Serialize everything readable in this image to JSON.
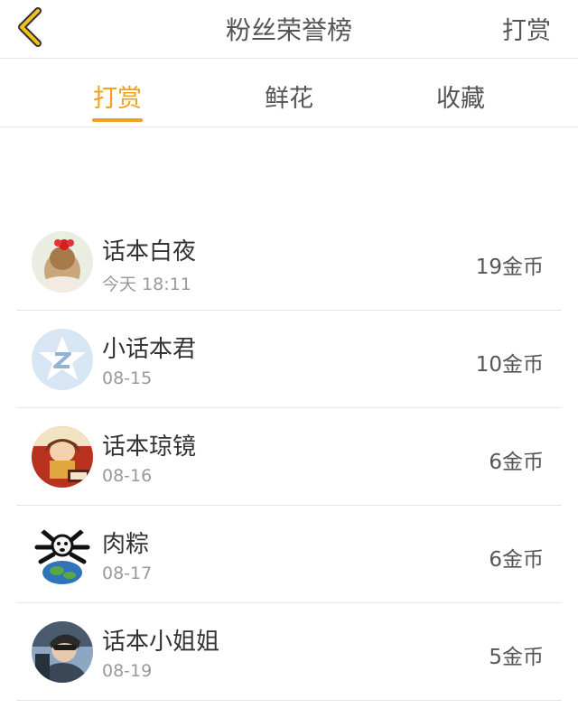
{
  "header": {
    "title": "粉丝荣誉榜",
    "action_label": "打赏",
    "back_icon": "chevron-left-icon",
    "accent_color": "#f0a01c"
  },
  "tabs": [
    {
      "label": "打赏",
      "active": true
    },
    {
      "label": "鲜花",
      "active": false
    },
    {
      "label": "收藏",
      "active": false
    }
  ],
  "fans": [
    {
      "name": "话本白夜",
      "date": "今天 18:11",
      "amount": "19金币",
      "avatar": "girl-with-red-bow-avatar"
    },
    {
      "name": "小话本君",
      "date": "08-15",
      "amount": "10金币",
      "avatar": "blue-star-logo-avatar"
    },
    {
      "name": "话本琼镜",
      "date": "08-16",
      "amount": "6金币",
      "avatar": "anime-character-avatar"
    },
    {
      "name": "肉粽",
      "date": "08-17",
      "amount": "6金币",
      "avatar": "cartoon-on-globe-avatar"
    },
    {
      "name": "话本小姐姐",
      "date": "08-19",
      "amount": "5金币",
      "avatar": "person-photo-avatar"
    }
  ]
}
